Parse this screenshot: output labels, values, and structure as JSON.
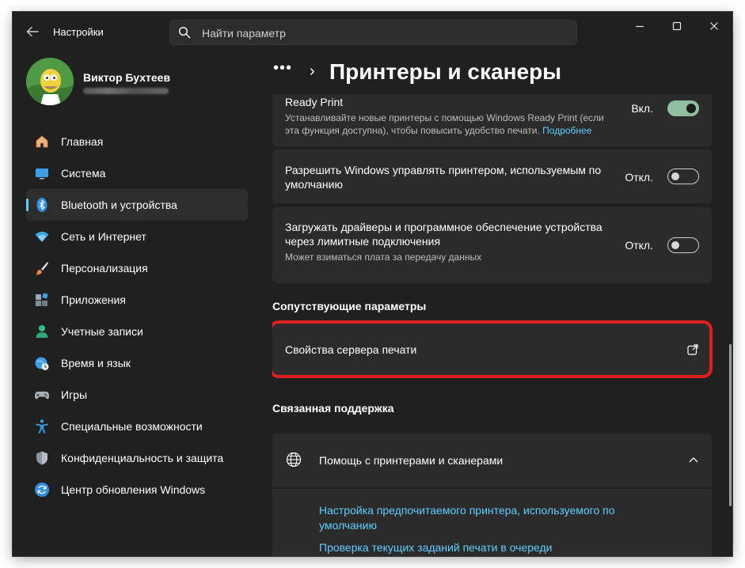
{
  "window": {
    "app_title": "Настройки"
  },
  "search": {
    "placeholder": "Найти параметр"
  },
  "profile": {
    "name": "Виктор Бухтеев"
  },
  "nav": {
    "items": [
      {
        "label": "Главная",
        "icon": "home-icon"
      },
      {
        "label": "Система",
        "icon": "monitor-icon"
      },
      {
        "label": "Bluetooth и устройства",
        "icon": "bluetooth-icon"
      },
      {
        "label": "Сеть и Интернет",
        "icon": "wifi-icon"
      },
      {
        "label": "Персонализация",
        "icon": "brush-icon"
      },
      {
        "label": "Приложения",
        "icon": "apps-icon"
      },
      {
        "label": "Учетные записи",
        "icon": "person-icon"
      },
      {
        "label": "Время и язык",
        "icon": "globe-clock-icon"
      },
      {
        "label": "Игры",
        "icon": "gamepad-icon"
      },
      {
        "label": "Специальные возможности",
        "icon": "accessibility-icon"
      },
      {
        "label": "Конфиденциальность и защита",
        "icon": "shield-icon"
      },
      {
        "label": "Центр обновления Windows",
        "icon": "update-icon"
      }
    ],
    "active_index": 2
  },
  "breadcrumb": {
    "dots": "•••",
    "chevron": "›",
    "title": "Принтеры и сканеры"
  },
  "settings": {
    "ready_print": {
      "title": "Ready Print",
      "desc_line1": "Устанавливайте новые принтеры с помощью Windows Ready Print (если",
      "desc_line2": "эта функция доступна), чтобы повысить удобство печати.",
      "link": "Подробнее",
      "toggle_label": "Вкл.",
      "toggle_on": true
    },
    "default_printer": {
      "title_line1": "Разрешить Windows управлять принтером, используемым по",
      "title_line2": "умолчанию",
      "toggle_label": "Откл.",
      "toggle_on": false
    },
    "metered": {
      "title_line1": "Загружать драйверы и программное обеспечение устройства",
      "title_line2": "через лимитные подключения",
      "desc": "Может взиматься плата за передачу данных",
      "toggle_label": "Откл.",
      "toggle_on": false
    }
  },
  "related": {
    "heading": "Сопутствующие параметры",
    "print_server": "Свойства сервера печати"
  },
  "support": {
    "heading": "Связанная поддержка",
    "help_title": "Помощь с принтерами и сканерами",
    "link1_line1": "Настройка предпочитаемого принтера, используемого по",
    "link1_line2": "умолчанию",
    "link2": "Проверка текущих заданий печати в очереди"
  },
  "colors": {
    "accent": "#60cdff",
    "highlight": "#e01f1f",
    "toggle_on": "#8fbfa0",
    "background": "#202020",
    "card": "#2b2b2b"
  }
}
